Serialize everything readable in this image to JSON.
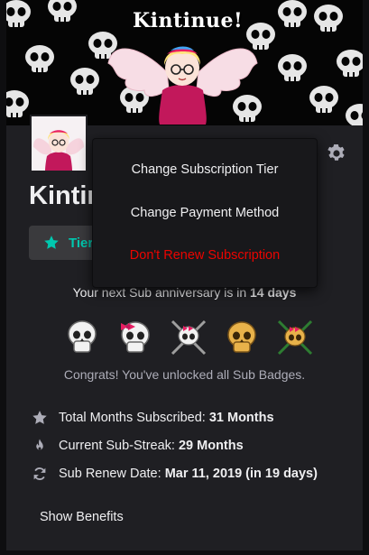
{
  "banner": {
    "title": "Kintinue!"
  },
  "channel": {
    "name": "Kintinue!"
  },
  "tier_button": {
    "label": "Tier 1"
  },
  "menu": {
    "items": [
      {
        "label": "Change Subscription Tier",
        "color": "#efeff1"
      },
      {
        "label": "Change Payment Method",
        "color": "#efeff1"
      },
      {
        "label": "Don't Renew Subscription",
        "color": "#eb0400"
      }
    ]
  },
  "anniversary": {
    "prefix": "Your next Sub anniversary is in ",
    "value": "14 days"
  },
  "badges": [
    {
      "icon": "skull-badge-white"
    },
    {
      "icon": "skull-badge-pink-bow"
    },
    {
      "icon": "skull-badge-crossed-swords"
    },
    {
      "icon": "skull-badge-gold"
    },
    {
      "icon": "skull-badge-crossed-swords-green"
    }
  ],
  "congrats": "Congrats! You've unlocked all Sub Badges.",
  "stats": {
    "months": {
      "label": "Total Months Subscribed: ",
      "value": "31 Months",
      "icon": "star-icon"
    },
    "streak": {
      "label": "Current Sub-Streak: ",
      "value": "29 Months",
      "icon": "flame-icon"
    },
    "renew": {
      "label": "Sub Renew Date: ",
      "value": "Mar 11, 2019 (in 19 days)",
      "icon": "renew-icon"
    }
  },
  "show_benefits": "Show Benefits",
  "colors": {
    "accent": "#00c8af",
    "danger": "#eb0400",
    "background": "#1f1f23",
    "icon_gray": "#adadb8"
  }
}
